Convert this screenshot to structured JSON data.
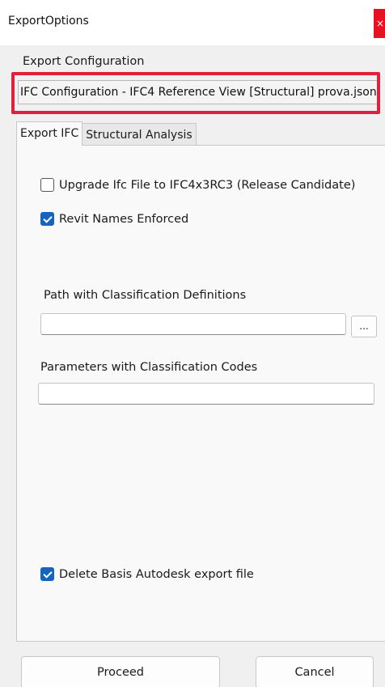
{
  "window": {
    "title": "ExportOptions",
    "close_glyph": "×"
  },
  "export_configuration": {
    "label": "Export Configuration",
    "selected": "IFC Configuration - IFC4 Reference View [Structural] prova.json",
    "highlight_color": "#e0203c"
  },
  "tabs": [
    {
      "label": "Export IFC",
      "active": true
    },
    {
      "label": "Structural Analysis",
      "active": false
    }
  ],
  "export_ifc": {
    "upgrade_checkbox": {
      "label": "Upgrade Ifc File to IFC4x3RC3 (Release Candidate)",
      "checked": false
    },
    "revit_names_checkbox": {
      "label": "Revit Names Enforced",
      "checked": true
    },
    "classification_path": {
      "label": "Path with Classification Definitions",
      "value": "",
      "browse_label": "..."
    },
    "classification_params": {
      "label": "Parameters with Classification Codes",
      "value": ""
    },
    "delete_basis_checkbox": {
      "label": "Delete Basis Autodesk export file",
      "checked": true
    }
  },
  "footer": {
    "proceed_label": "Proceed",
    "cancel_label": "Cancel"
  },
  "colors": {
    "checkbox_checked": "#1565c0",
    "close_button": "#e81123"
  }
}
